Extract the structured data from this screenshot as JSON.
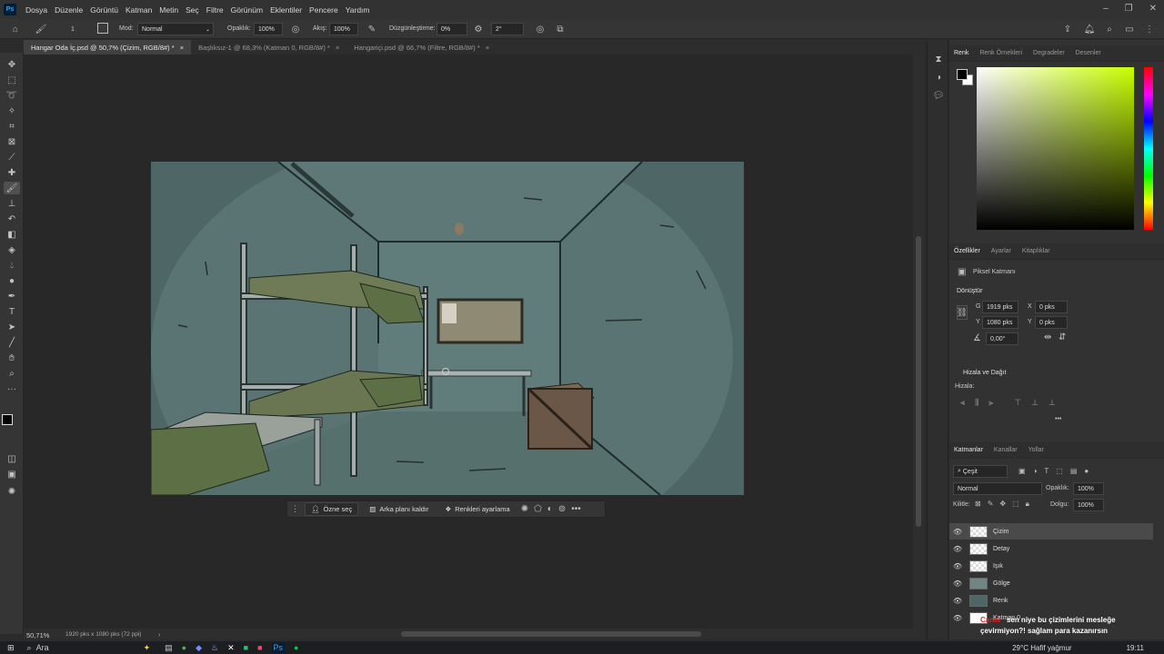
{
  "menu": [
    "Dosya",
    "Düzenle",
    "Görüntü",
    "Katman",
    "Metin",
    "Seç",
    "Filtre",
    "Görünüm",
    "Eklentiler",
    "Pencere",
    "Yardım"
  ],
  "app_badge": "Ps",
  "options": {
    "mode_label": "Mod:",
    "mode_value": "Normal",
    "opacity_label": "Opaklık:",
    "opacity_value": "100%",
    "flow_label": "Akış:",
    "flow_value": "100%",
    "smoothing_label": "Düzgünleştirme:",
    "smoothing_value": "0%",
    "angle_value": "2°",
    "brush_size": "1"
  },
  "tabs": [
    {
      "label": "Hangar Oda İç.psd @ 50,7% (Çizim, RGB/8#) *",
      "close": "×"
    },
    {
      "label": "Başlıksız-1 @ 68,3% (Katman 0, RGB/8#) *",
      "close": "×"
    },
    {
      "label": "Hangariçi.psd @ 66,7% (Filtre, RGB/8#) *",
      "close": "×"
    }
  ],
  "context_bar": {
    "select_subject": "Özne seç",
    "remove_bg": "Arka planı kaldır",
    "adjust_colors": "Renkleri ayarlama",
    "more": "•••"
  },
  "status": {
    "zoom": "50,71%",
    "doc_info": "1920 pks x 1080 pks (72 ppi)"
  },
  "color_panel": {
    "tabs": [
      "Renk",
      "Renk Örnekleri",
      "Degradeler",
      "Desenler"
    ],
    "hue_base": "#c8ff00"
  },
  "properties": {
    "tabs": [
      "Özellikler",
      "Ayarlar",
      "Kitaplıklar"
    ],
    "kind": "Piksel Katmanı",
    "transform_title": "Dönüştür",
    "w_label": "G",
    "w_value": "1919 pks",
    "h_label": "Y",
    "h_value": "1080 pks",
    "x_label": "X",
    "x_value": "0 pks",
    "y_label": "Y",
    "y_value": "0 pks",
    "angle": "0,00°",
    "align_title": "Hizala ve Dağıt",
    "align_label": "Hizala:",
    "more": "•••"
  },
  "layers_panel": {
    "tabs": [
      "Katmanlar",
      "Kanallar",
      "Yollar"
    ],
    "filter": "Çeşit",
    "blend": "Normal",
    "opacity_label": "Opaklık:",
    "opacity_value": "100%",
    "lock_label": "Kilitle:",
    "fill_label": "Dolgu:",
    "fill_value": "100%",
    "layers": [
      "Çizim",
      "Detay",
      "Işık",
      "Gölge",
      "Renk",
      "Katman 0"
    ]
  },
  "stream_overlay": {
    "tag": "Caner",
    "message": "sen niye bu çizimlerini mesleğe çevirmiyon?! sağlam para kazanırsın"
  },
  "taskbar": {
    "search": "Ara",
    "weather": "29°C  Hafif yağmur",
    "time": "19:11"
  }
}
